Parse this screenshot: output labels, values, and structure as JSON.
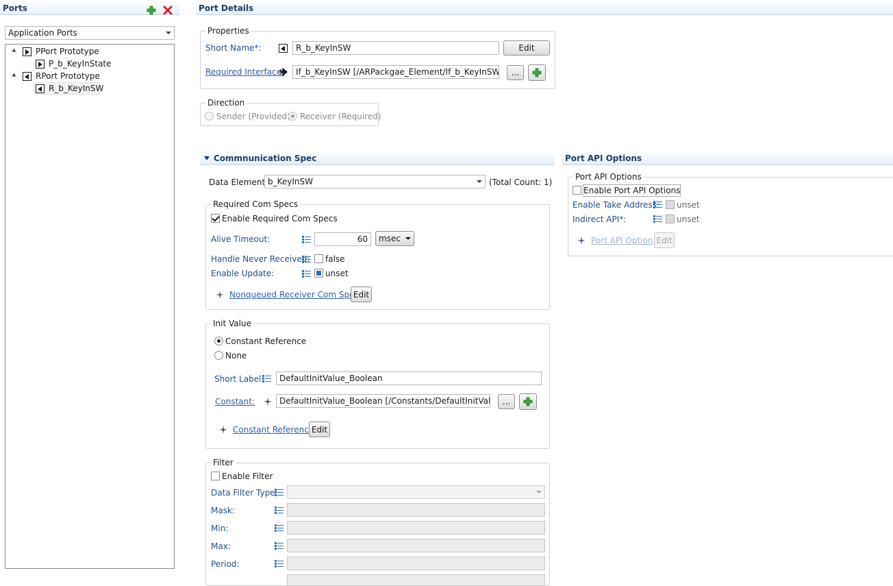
{
  "ports_panel": {
    "title": "Ports",
    "filter_value": "Application Ports",
    "tree": [
      {
        "label": "PPort Prototype",
        "children": [
          "P_b_KeyInState"
        ]
      },
      {
        "label": "RPort Prototype",
        "children": [
          "R_b_KeyInSW"
        ]
      }
    ]
  },
  "port_details": {
    "title": "Port Details",
    "properties": {
      "group_title": "Properties",
      "short_name_label": "Short Name*:",
      "short_name_value": "R_b_KeyInSW",
      "edit_label": "Edit",
      "required_interface_label": "Required Interface:",
      "required_interface_value": "If_b_KeyInSW [/ARPackgae_Element/If_b_KeyInSW]",
      "browse_label": "..."
    },
    "direction": {
      "group_title": "Direction",
      "sender_label": "Sender (Provided)",
      "receiver_label": "Receiver (Required)",
      "selected": "receiver"
    }
  },
  "communication_spec": {
    "title": "Commnunication Spec",
    "data_elements_label": "Data Elements",
    "data_elements_value": "b_KeyInSW",
    "total_count": "(Total Count: 1)",
    "required_com_specs": {
      "group_title": "Required Com Specs",
      "enable_label": "Enable Required Com Specs",
      "enabled": true,
      "alive_timeout_label": "Alive Timeout:",
      "alive_timeout_value": "60",
      "alive_timeout_unit": "msec",
      "handle_never_received_label": "Handle Never Received:",
      "handle_never_received_value": "false",
      "enable_update_label": "Enable Update:",
      "enable_update_value": "unset",
      "nonqueued_link": "Nonqueued Receiver Com Spec",
      "edit_label": "Edit"
    },
    "init_value": {
      "group_title": "Init Value",
      "constant_reference_label": "Constant Reference",
      "none_label": "None",
      "selected": "constant_reference",
      "short_label_label": "Short Label:",
      "short_label_value": "DefaultInitValue_Boolean",
      "constant_label": "Constant:",
      "constant_value": "DefaultInitValue_Boolean [/Constants/DefaultInitValue_Bo",
      "browse_label": "...",
      "constant_reference_link": "Constant Reference",
      "edit_label": "Edit"
    },
    "filter": {
      "group_title": "Filter",
      "enable_label": "Enable Filter",
      "enabled": false,
      "data_filter_type_label": "Data Filter Type:",
      "data_filter_type_value": "",
      "mask_label": "Mask:",
      "min_label": "Min:",
      "max_label": "Max:",
      "period_label": "Period:"
    }
  },
  "port_api_options": {
    "title": "Port API Options",
    "group_title": "Port API Options",
    "enable_label": "Enable Port API Options",
    "enabled": false,
    "enable_take_address_label": "Enable Take Address:",
    "enable_take_address_value": "unset",
    "indirect_api_label": "Indirect API*:",
    "indirect_api_value": "unset",
    "port_api_option_link": "Port API Option",
    "edit_label": "Edit"
  },
  "colors": {
    "header_text": "#1f3f6a",
    "link": "#2a5db0",
    "add_icon": "#3aa63a",
    "remove_icon": "#d62020"
  }
}
